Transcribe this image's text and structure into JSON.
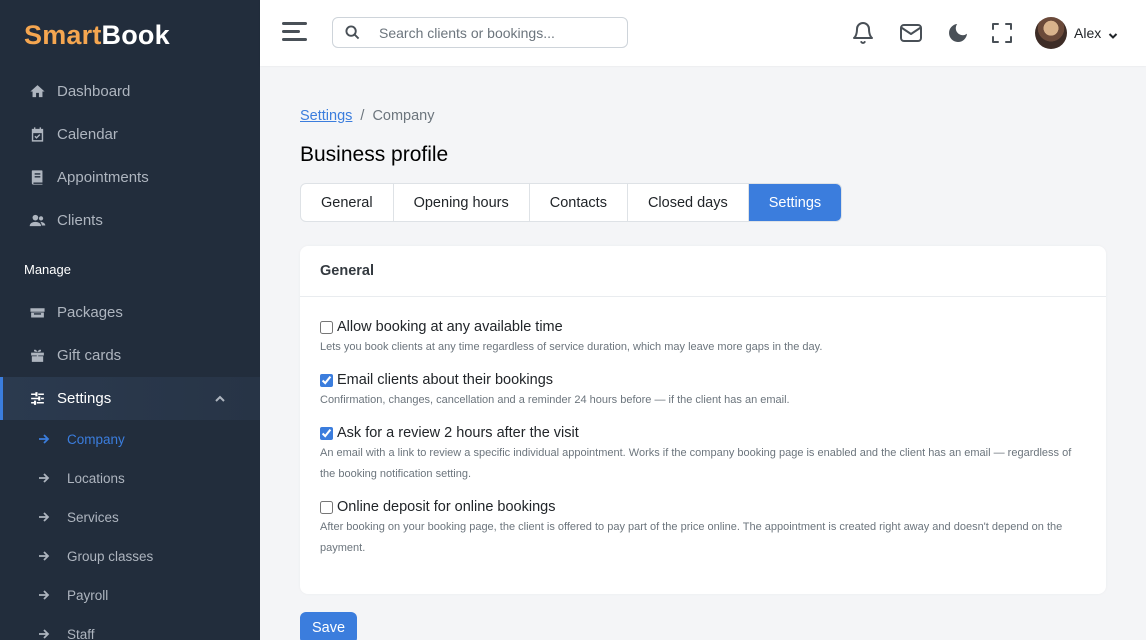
{
  "brand": {
    "part1": "Smart",
    "part2": "Book"
  },
  "sidebar": {
    "items": [
      {
        "label": "Dashboard",
        "icon": "home-icon"
      },
      {
        "label": "Calendar",
        "icon": "calendar-icon"
      },
      {
        "label": "Appointments",
        "icon": "book-icon"
      },
      {
        "label": "Clients",
        "icon": "users-icon"
      }
    ],
    "section_label": "Manage",
    "manage_items": [
      {
        "label": "Packages",
        "icon": "package-icon"
      },
      {
        "label": "Gift cards",
        "icon": "gift-icon"
      },
      {
        "label": "Settings",
        "icon": "sliders-icon",
        "active": true,
        "expanded": true
      }
    ],
    "sub_items": [
      {
        "label": "Company",
        "active": true
      },
      {
        "label": "Locations"
      },
      {
        "label": "Services"
      },
      {
        "label": "Group classes"
      },
      {
        "label": "Payroll"
      },
      {
        "label": "Staff"
      }
    ]
  },
  "topbar": {
    "search_placeholder": "Search clients or bookings...",
    "user_name": "Alex",
    "icons": [
      "bell-icon",
      "mail-icon",
      "moon-icon",
      "fullscreen-icon"
    ]
  },
  "breadcrumb": {
    "link": "Settings",
    "separator": "/",
    "current": "Company"
  },
  "page_title": "Business profile",
  "tabs": [
    {
      "label": "General"
    },
    {
      "label": "Opening hours"
    },
    {
      "label": "Contacts"
    },
    {
      "label": "Closed days"
    },
    {
      "label": "Settings",
      "active": true
    }
  ],
  "card": {
    "title": "General",
    "options": [
      {
        "label": "Allow booking at any available time",
        "checked": false,
        "description": "Lets you book clients at any time regardless of service duration, which may leave more gaps in the day."
      },
      {
        "label": "Email clients about their bookings",
        "checked": true,
        "description": "Confirmation, changes, cancellation and a reminder 24 hours before — if the client has an email."
      },
      {
        "label": "Ask for a review 2 hours after the visit",
        "checked": true,
        "description": "An email with a link to review a specific individual appointment. Works if the company booking page is enabled and the client has an email — regardless of the booking notification setting."
      },
      {
        "label": "Online deposit for online bookings",
        "checked": false,
        "description": "After booking on your booking page, the client is offered to pay part of the price online. The appointment is created right away and doesn't depend on the payment."
      }
    ]
  },
  "save_label": "Save",
  "colors": {
    "accent": "#3b7ddd",
    "sidebar_bg": "#222d3c",
    "brand_orange": "#f5a650"
  }
}
